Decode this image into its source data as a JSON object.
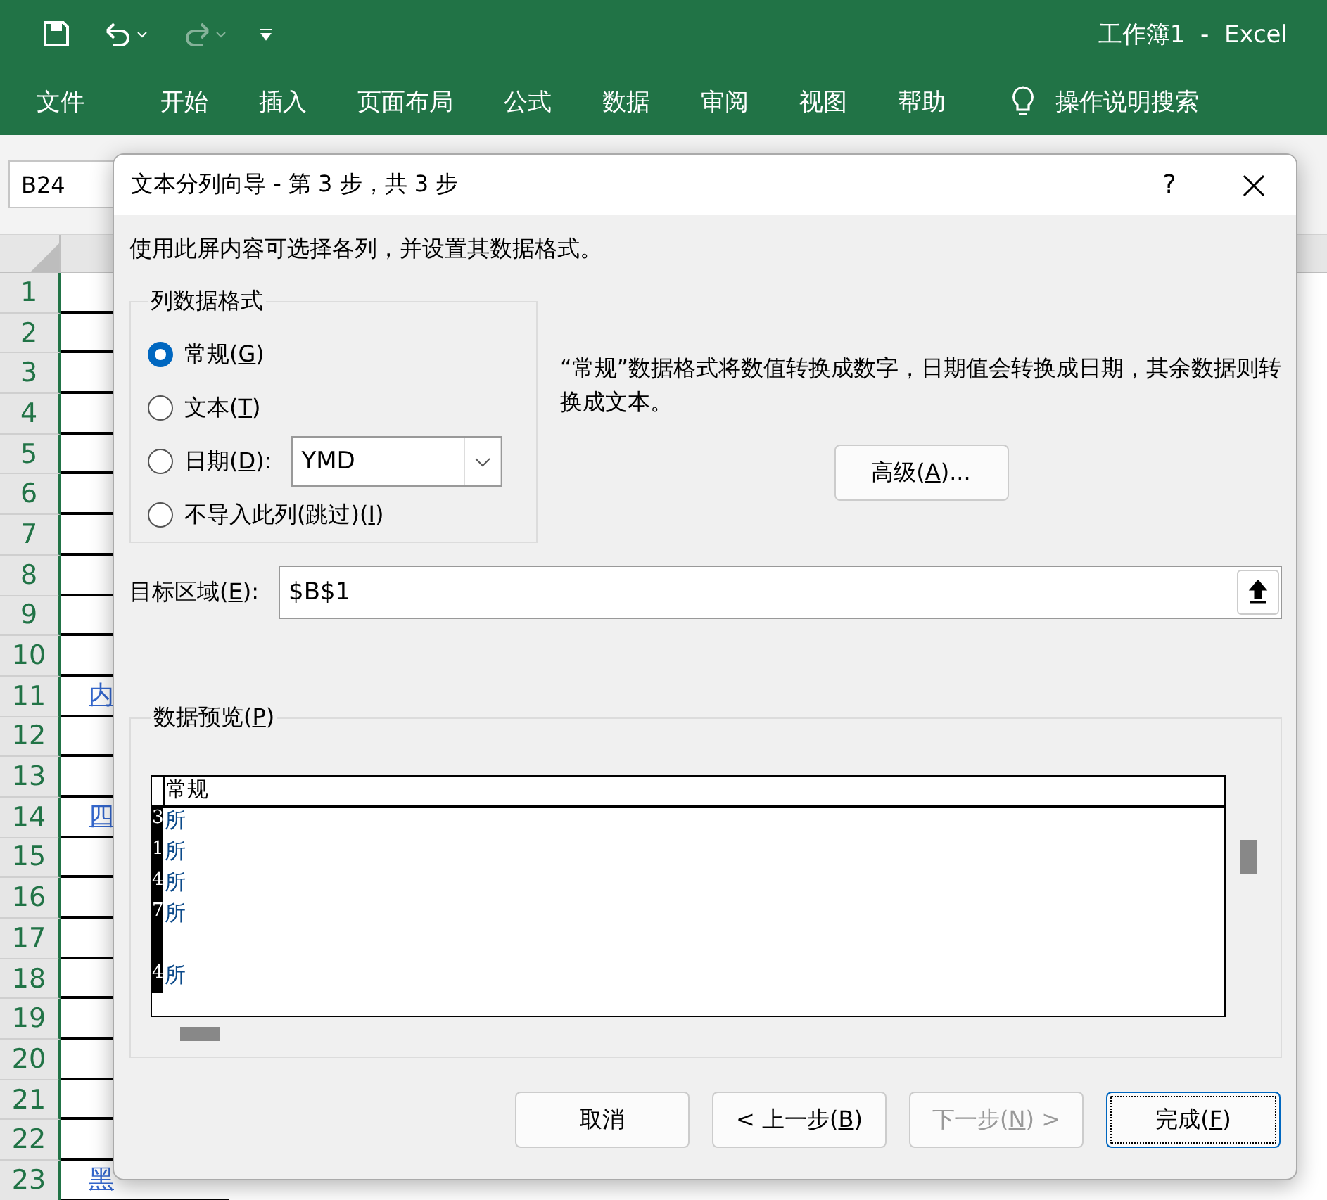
{
  "title_bar": {
    "title": "工作簿1  -  Excel"
  },
  "ribbon_tabs": [
    "文件",
    "开始",
    "插入",
    "页面布局",
    "公式",
    "数据",
    "审阅",
    "视图",
    "帮助"
  ],
  "tell_me": "操作说明搜索",
  "name_box": "B24",
  "sheet": {
    "rows": [
      {
        "number": "1",
        "cell": ""
      },
      {
        "number": "2",
        "cell": ""
      },
      {
        "number": "3",
        "cell": ""
      },
      {
        "number": "4",
        "cell": ""
      },
      {
        "number": "5",
        "cell": ""
      },
      {
        "number": "6",
        "cell": ""
      },
      {
        "number": "7",
        "cell": ""
      },
      {
        "number": "8",
        "cell": ""
      },
      {
        "number": "9",
        "cell": ""
      },
      {
        "number": "10",
        "cell": ""
      },
      {
        "number": "11",
        "cell": "内"
      },
      {
        "number": "12",
        "cell": ""
      },
      {
        "number": "13",
        "cell": ""
      },
      {
        "number": "14",
        "cell": "四"
      },
      {
        "number": "15",
        "cell": ""
      },
      {
        "number": "16",
        "cell": ""
      },
      {
        "number": "17",
        "cell": ""
      },
      {
        "number": "18",
        "cell": ""
      },
      {
        "number": "19",
        "cell": ""
      },
      {
        "number": "20",
        "cell": ""
      },
      {
        "number": "21",
        "cell": ""
      },
      {
        "number": "22",
        "cell": ""
      },
      {
        "number": "23",
        "cell": "黑"
      }
    ]
  },
  "dialog": {
    "title": "文本分列向导 - 第 3 步，共 3 步",
    "help": "?",
    "instruction": "使用此屏内容可选择各列，并设置其数据格式。",
    "format_group": {
      "legend": "列数据格式",
      "options": [
        {
          "label": "常规(**G**)",
          "selected": true
        },
        {
          "label": "文本(**T**)",
          "selected": false
        },
        {
          "label": "日期(**D**):",
          "selected": false,
          "kind": "date",
          "value": "YMD"
        },
        {
          "label": "不导入此列(跳过)(**I**)",
          "selected": false
        }
      ]
    },
    "description": "“常规”数据格式将数值转换成数字，日期值会转换成日期，其余数据则转换成文本。",
    "advanced_button": "高级(**A**)...",
    "destination": {
      "label": "目标区域(**E**):",
      "value": "$B$1"
    },
    "preview": {
      "legend": "数据预览(**P**)",
      "header": "常规",
      "rows": [
        {
          "column_1": "3",
          "column_2": "所"
        },
        {
          "column_1": "1",
          "column_2": "所"
        },
        {
          "column_1": "4",
          "column_2": "所"
        },
        {
          "column_1": "7",
          "column_2": "所"
        },
        {
          "column_1": "",
          "column_2": ""
        },
        {
          "column_1": "4",
          "column_2": "所"
        }
      ]
    },
    "buttons": [
      {
        "label": "取消",
        "disabled": false,
        "default": false
      },
      {
        "label": "< 上一步(**B**)",
        "disabled": false,
        "default": false
      },
      {
        "label": "下一步(**N**) >",
        "disabled": true,
        "default": false
      },
      {
        "label": "完成(**F**)",
        "disabled": false,
        "default": true
      }
    ]
  }
}
